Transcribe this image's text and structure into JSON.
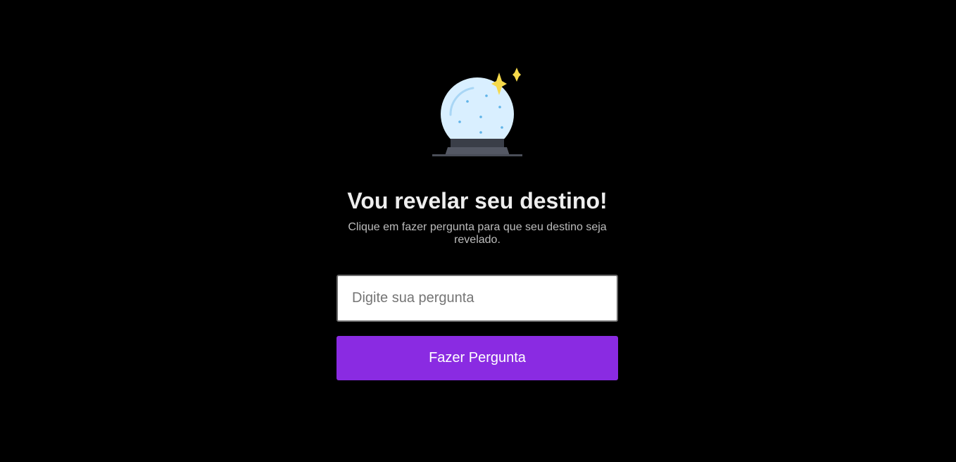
{
  "header": {
    "icon": "crystal-ball-icon",
    "title": "Vou revelar seu destino!",
    "subtitle": "Clique em fazer pergunta para que seu destino seja revelado."
  },
  "form": {
    "question_placeholder": "Digite sua pergunta",
    "question_value": "",
    "ask_button_label": "Fazer Pergunta"
  },
  "colors": {
    "background": "#000000",
    "accent": "#8a2be2",
    "sparkle": "#f5d94a",
    "globe": "#d9efff"
  }
}
